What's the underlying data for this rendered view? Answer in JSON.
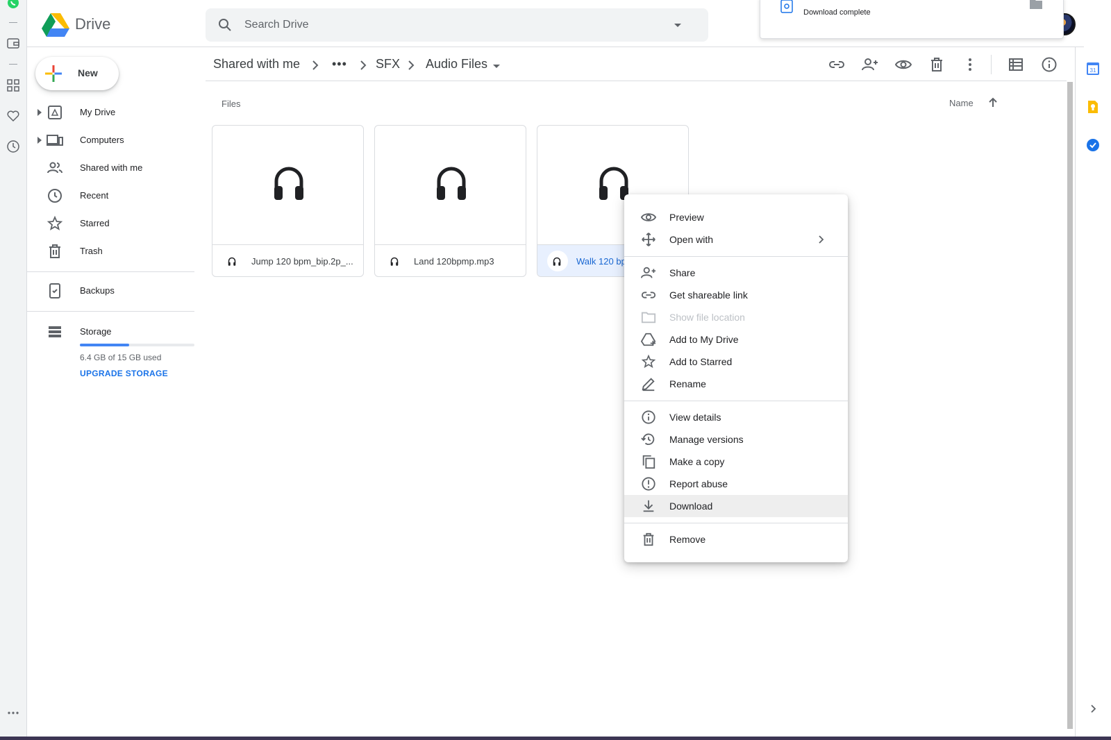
{
  "app": {
    "brand": "Drive"
  },
  "search": {
    "placeholder": "Search Drive"
  },
  "notification": {
    "status": "Download complete"
  },
  "new_button": {
    "label": "New"
  },
  "sidebar": {
    "items": [
      {
        "label": "My Drive",
        "icon": "my-drive-icon"
      },
      {
        "label": "Computers",
        "icon": "computers-icon"
      },
      {
        "label": "Shared with me",
        "icon": "shared-icon"
      },
      {
        "label": "Recent",
        "icon": "clock-icon"
      },
      {
        "label": "Starred",
        "icon": "star-icon"
      },
      {
        "label": "Trash",
        "icon": "trash-icon"
      }
    ],
    "backups": {
      "label": "Backups",
      "icon": "backups-icon"
    },
    "storage": {
      "label": "Storage",
      "used_text": "6.4 GB of 15 GB used",
      "used_fraction": 0.43,
      "upgrade": "UPGRADE STORAGE"
    }
  },
  "breadcrumb": {
    "items": [
      "Shared with me",
      "•••",
      "SFX",
      "Audio Files"
    ]
  },
  "files_section": {
    "label": "Files",
    "sort_label": "Name"
  },
  "files": [
    {
      "name": "Jump 120 bpm_bip.2p_...",
      "selected": false
    },
    {
      "name": "Land 120bpmp.mp3",
      "selected": false
    },
    {
      "name": "Walk 120 bp",
      "selected": true
    }
  ],
  "context_menu": {
    "groups": [
      [
        {
          "label": "Preview",
          "icon": "eye-icon"
        },
        {
          "label": "Open with",
          "icon": "move-icon",
          "submenu": true
        }
      ],
      [
        {
          "label": "Share",
          "icon": "person-add-icon"
        },
        {
          "label": "Get shareable link",
          "icon": "link-icon"
        },
        {
          "label": "Show file location",
          "icon": "folder-icon",
          "disabled": true
        },
        {
          "label": "Add to My Drive",
          "icon": "drive-add-icon"
        },
        {
          "label": "Add to Starred",
          "icon": "star-icon"
        },
        {
          "label": "Rename",
          "icon": "pencil-icon"
        }
      ],
      [
        {
          "label": "View details",
          "icon": "info-icon"
        },
        {
          "label": "Manage versions",
          "icon": "history-icon"
        },
        {
          "label": "Make a copy",
          "icon": "copy-icon"
        },
        {
          "label": "Report abuse",
          "icon": "alert-icon"
        },
        {
          "label": "Download",
          "icon": "download-icon",
          "highlighted": true
        }
      ],
      [
        {
          "label": "Remove",
          "icon": "trash-icon"
        }
      ]
    ]
  },
  "right_panel": {
    "calendar_day": "31"
  },
  "colors": {
    "accent": "#1a73e8",
    "selected_bg": "#e8f0fe",
    "storage_fill": "#4285f4"
  }
}
